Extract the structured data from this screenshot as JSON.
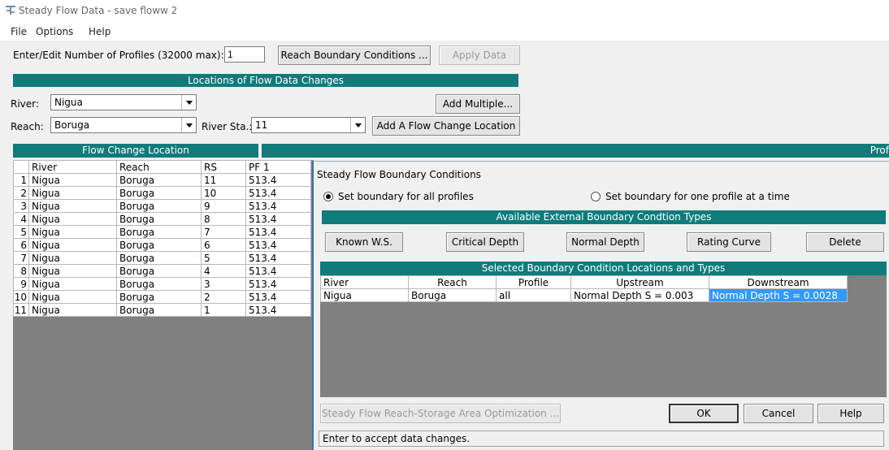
{
  "window": {
    "title": "Steady Flow Data - save floww 2",
    "icon": "flow-data-icon"
  },
  "menu": [
    "File",
    "Options",
    "Help"
  ],
  "toolbar": {
    "profiles_label": "Enter/Edit Number of Profiles (32000 max):",
    "profiles_value": "1",
    "reach_bc_button": "Reach Boundary Conditions ...",
    "apply_button": "Apply Data"
  },
  "locations": {
    "header": "Locations of Flow Data Changes",
    "river_label": "River:",
    "river_value": "Nigua",
    "reach_label": "Reach:",
    "reach_value": "Boruga",
    "station_label": "River Sta.:",
    "station_value": "11",
    "add_multiple_button": "Add Multiple...",
    "add_location_button": "Add A Flow Change Location"
  },
  "flow_table": {
    "section_header": "Flow Change Location",
    "right_header": "Prof",
    "columns": [
      "River",
      "Reach",
      "RS",
      "PF 1"
    ],
    "rows": [
      [
        "1",
        "Nigua",
        "Boruga",
        "11",
        "513.4"
      ],
      [
        "2",
        "Nigua",
        "Boruga",
        "10",
        "513.4"
      ],
      [
        "3",
        "Nigua",
        "Boruga",
        "9",
        "513.4"
      ],
      [
        "4",
        "Nigua",
        "Boruga",
        "8",
        "513.4"
      ],
      [
        "5",
        "Nigua",
        "Boruga",
        "7",
        "513.4"
      ],
      [
        "6",
        "Nigua",
        "Boruga",
        "6",
        "513.4"
      ],
      [
        "7",
        "Nigua",
        "Boruga",
        "5",
        "513.4"
      ],
      [
        "8",
        "Nigua",
        "Boruga",
        "4",
        "513.4"
      ],
      [
        "9",
        "Nigua",
        "Boruga",
        "3",
        "513.4"
      ],
      [
        "10",
        "Nigua",
        "Boruga",
        "2",
        "513.4"
      ],
      [
        "11",
        "Nigua",
        "Boruga",
        "1",
        "513.4"
      ]
    ]
  },
  "dialog": {
    "title": "Steady Flow Boundary Conditions",
    "radio_all": "Set boundary for all profiles",
    "radio_one": "Set boundary for one profile at a time",
    "types_header": "Available External Boundary Condtion Types",
    "known_ws_button": "Known W.S.",
    "critical_depth_button": "Critical Depth",
    "normal_depth_button": "Normal Depth",
    "rating_curve_button": "Rating Curve",
    "delete_button": "Delete",
    "selected_header": "Selected Boundary Condition Locations and Types",
    "bc_columns": [
      "River",
      "Reach",
      "Profile",
      "Upstream",
      "Downstream"
    ],
    "bc_rows": [
      [
        "Nigua",
        "Boruga",
        "all",
        "Normal Depth S = 0.003",
        "Normal Depth S = 0.0028"
      ]
    ],
    "optimization_button": "Steady Flow Reach-Storage Area Optimization ...",
    "ok_button": "OK",
    "cancel_button": "Cancel",
    "help_button": "Help",
    "status_text": "Enter to accept data changes."
  },
  "colors": {
    "section_header": "#0f7b7b",
    "grid_background": "#808080",
    "selection": "#3399ff"
  }
}
